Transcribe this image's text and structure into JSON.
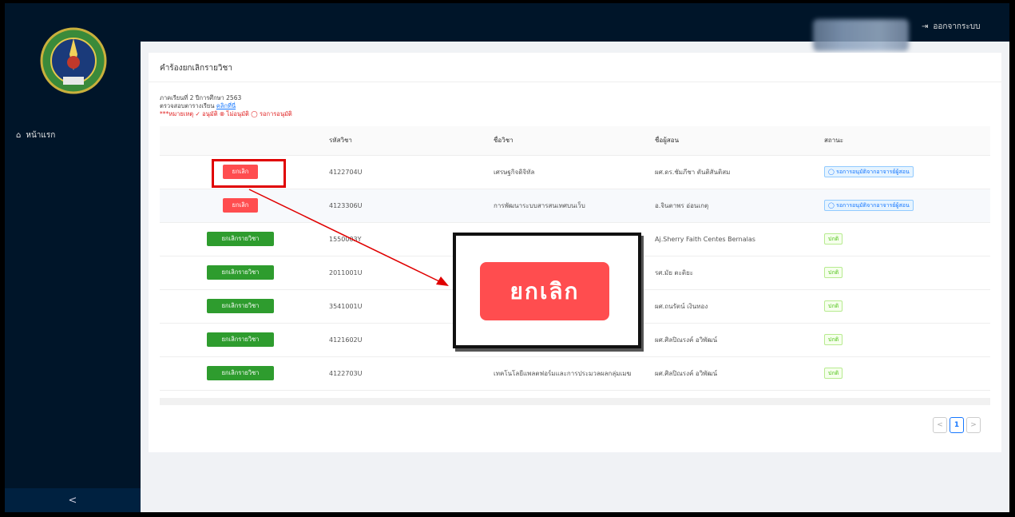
{
  "sidebar": {
    "nav_home": "หน้าแรก",
    "collapse_label": "<"
  },
  "header": {
    "logout_label": "ออกจากระบบ"
  },
  "page": {
    "title": "คำร้องยกเลิกรายวิชา",
    "semester_text": "ภาคเรียนที่ 2 ปีการศึกษา 2563",
    "timetable_text": "ตรวจสอบตารางเรียน",
    "timetable_link": "คลิกที่นี่",
    "legend": "***หมายเหตุ ✓ อนุมัติ ⊗ ไม่อนุมัติ ◯ รอการอนุมัติ"
  },
  "table": {
    "headers": [
      "",
      "รหัสวิชา",
      "ชื่อวิชา",
      "ชื่อผู้สอน",
      "สถานะ"
    ],
    "rows": [
      {
        "action": "ยกเลิก",
        "code": "4122704U",
        "name": "เศรษฐกิจดิจิทัล",
        "teacher": "ผศ.ดร.ชัมภีชา ตันติสันติสม",
        "status": "◯ รอการอนุมัติจากอาจารย์ผู้สอน"
      },
      {
        "action": "ยกเลิก",
        "code": "4123306U",
        "name": "การพัฒนาระบบสารสนเทศบนเว็บ",
        "teacher": "อ.จินตาพร อ่อนเกตุ",
        "status": "◯ รอการอนุมัติจากอาจารย์ผู้สอน"
      },
      {
        "action": "ยกเลิกรายวิชา",
        "code": "1550003Y",
        "name": "",
        "teacher": "Aj.Sherry Faith Centes Bernalas",
        "status": "ปกติ"
      },
      {
        "action": "ยกเลิกรายวิชา",
        "code": "2011001U",
        "name": "",
        "teacher": "รศ.มัย ตะติยะ",
        "status": "ปกติ"
      },
      {
        "action": "ยกเลิกรายวิชา",
        "code": "3541001U",
        "name": "",
        "teacher": "ผศ.ถนรัตน์ เงินทอง",
        "status": "ปกติ"
      },
      {
        "action": "ยกเลิกรายวิชา",
        "code": "4121602U",
        "name": "",
        "teacher": "ผศ.ศิลปิณรงค์ อวิพัฒน์",
        "status": "ปกติ"
      },
      {
        "action": "ยกเลิกรายวิชา",
        "code": "4122703U",
        "name": "เทคโนโลยีแพลตฟอร์มและการประมวลผลกลุ่มเมฆ",
        "teacher": "ผศ.ศิลปิณรงค์ อวิพัฒน์",
        "status": "ปกติ"
      }
    ]
  },
  "pagination": {
    "prev": "<",
    "current": "1",
    "next": ">"
  },
  "callout": {
    "zoom_label": "ยกเลิก"
  },
  "colors": {
    "cancel": "#ff4d4f",
    "withdraw": "#2e9c2e",
    "highlight": "#e00000",
    "sidebar": "#001529"
  }
}
